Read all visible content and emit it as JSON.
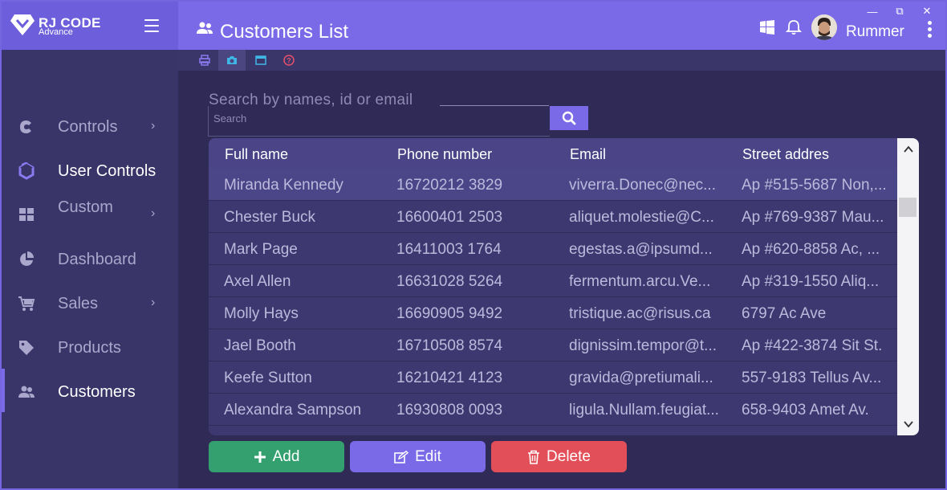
{
  "app": {
    "logo_title": "RJ CODE",
    "logo_subtitle": "Advance",
    "page_title": "Customers List",
    "username": "Rummer"
  },
  "window_controls": {
    "minimize": "—",
    "maximize": "⧉",
    "close": "✕"
  },
  "sidebar": {
    "items": [
      {
        "label": "Controls",
        "icon": "c-icon",
        "has_chevron": true
      },
      {
        "label": "User Controls",
        "icon": "hexagon-icon",
        "has_chevron": false
      },
      {
        "label": "Custom",
        "icon": "grid-icon",
        "has_chevron": true
      },
      {
        "label": "Dashboard",
        "icon": "pie-chart-icon",
        "has_chevron": false
      },
      {
        "label": "Sales",
        "icon": "cart-icon",
        "has_chevron": true
      },
      {
        "label": "Products",
        "icon": "tag-icon",
        "has_chevron": false
      },
      {
        "label": "Customers",
        "icon": "users-icon",
        "has_chevron": false
      }
    ],
    "chevron": "›"
  },
  "toolbar": {
    "tools": [
      "print-icon",
      "camera-icon",
      "window-icon",
      "help-icon"
    ]
  },
  "search": {
    "label": "Search by names, id or email",
    "placeholder": "Search"
  },
  "table": {
    "columns": [
      "Full name",
      "Phone number",
      "Email",
      "Street addres"
    ],
    "rows": [
      [
        "Miranda Kennedy",
        "16720212 3829",
        "viverra.Donec@nec...",
        "Ap #515-5687 Non,..."
      ],
      [
        "Chester Buck",
        "16600401 2503",
        "aliquet.molestie@C...",
        "Ap #769-9387 Mau..."
      ],
      [
        "Mark Page",
        "16411003 1764",
        "egestas.a@ipsumd...",
        "Ap #620-8858 Ac, ..."
      ],
      [
        "Axel Allen",
        "16631028 5264",
        "fermentum.arcu.Ve...",
        "Ap #319-1550 Aliq..."
      ],
      [
        "Molly Hays",
        "16690905 9492",
        "tristique.ac@risus.ca",
        "6797 Ac Ave"
      ],
      [
        "Jael Booth",
        "16710508 8574",
        "dignissim.tempor@t...",
        "Ap #422-3874 Sit St."
      ],
      [
        "Keefe Sutton",
        "16210421 4123",
        "gravida@pretiumali...",
        "557-9183 Tellus Av..."
      ],
      [
        "Alexandra Sampson",
        "16930808 0093",
        "ligula.Nullam.feugiat...",
        "658-9403 Amet Av."
      ]
    ]
  },
  "actions": {
    "add": "Add",
    "edit": "Edit",
    "delete": "Delete"
  },
  "colors": {
    "header": "#7b6ae8",
    "sidebar": "#3a3568",
    "add": "#34a06f",
    "edit": "#7b6ae8",
    "delete": "#e24f58"
  }
}
